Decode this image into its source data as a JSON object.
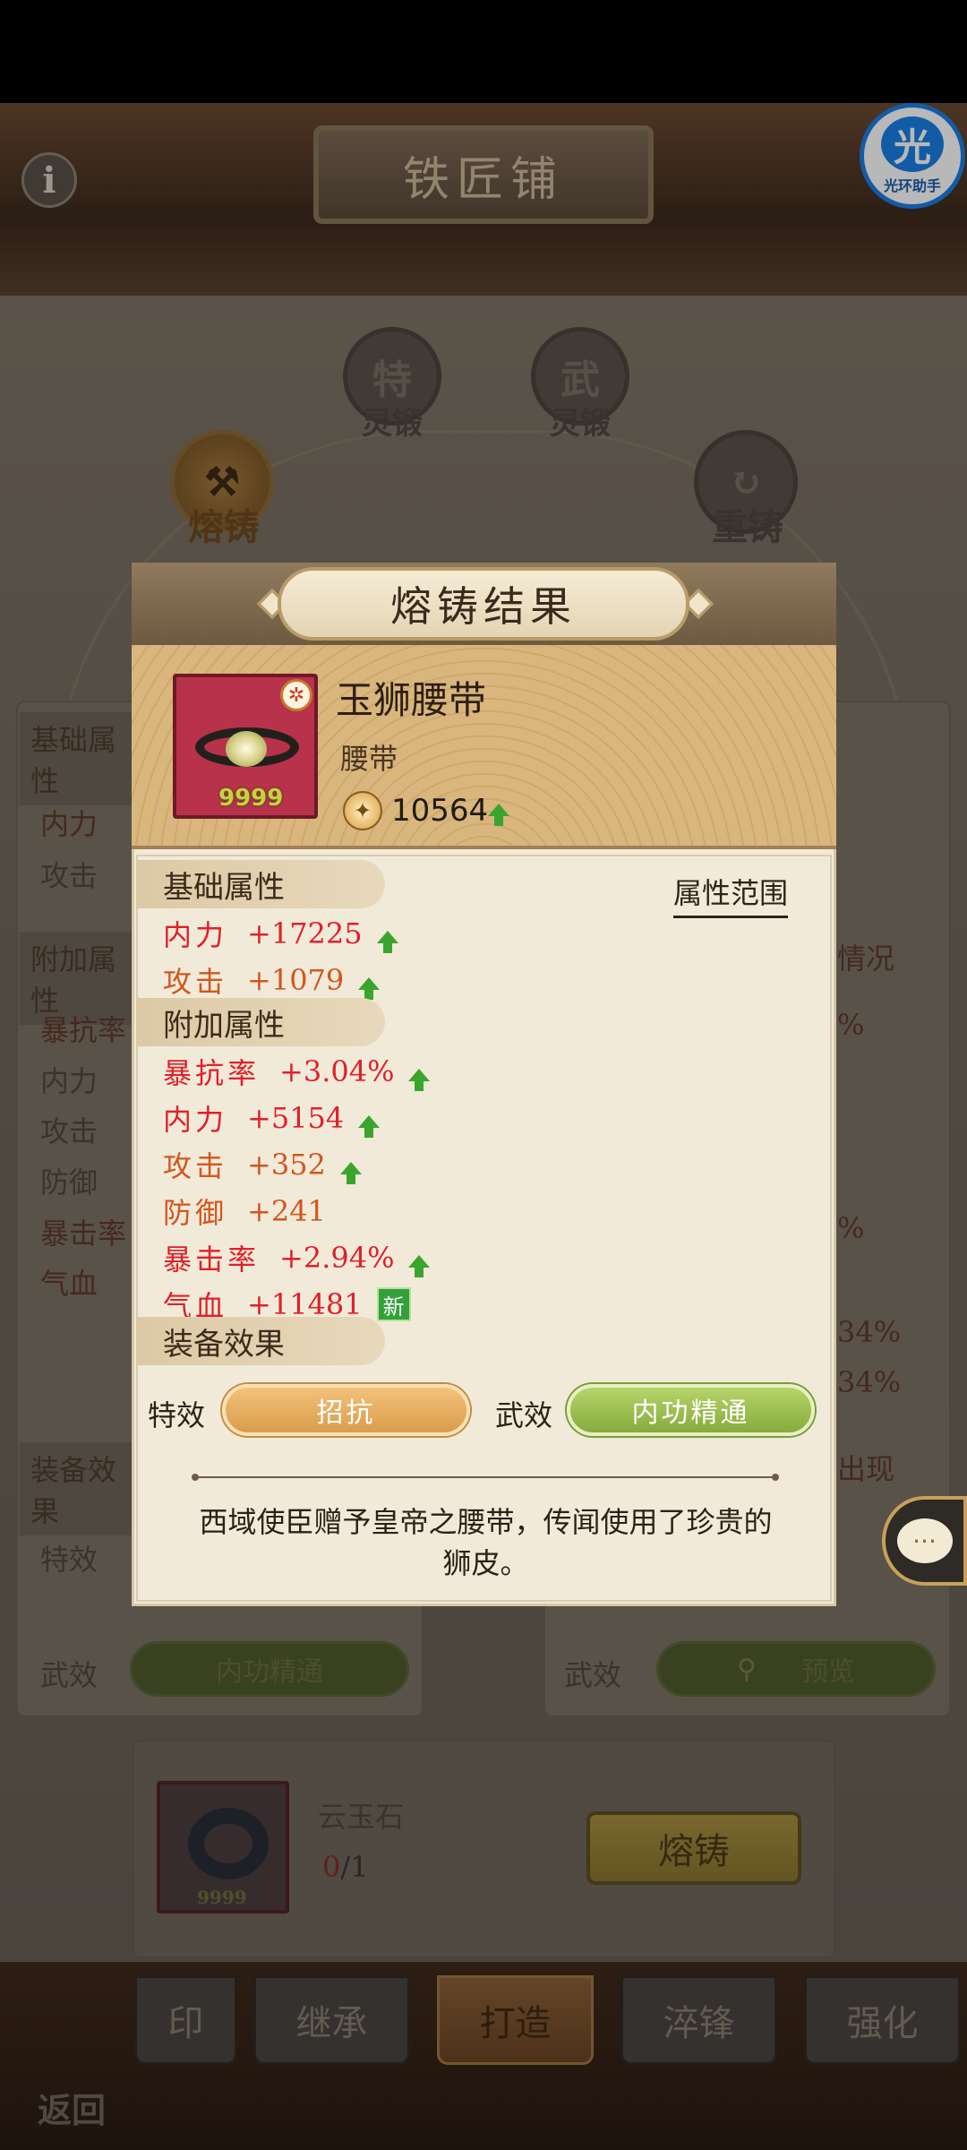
{
  "screen": {
    "title": "铁匠铺",
    "badge_label": "光环助手",
    "badge_glyph": "光"
  },
  "background": {
    "mode_buttons": [
      {
        "label": "特\n灵锻",
        "glyph": "特",
        "caption": "灵锻"
      },
      {
        "label": "武\n灵锻",
        "glyph": "武",
        "caption": "灵锻"
      },
      {
        "label": "熔铸"
      },
      {
        "label": "重铸"
      }
    ],
    "left_panel": {
      "base_title": "基础属性",
      "base_rows": [
        "内力",
        "攻击"
      ],
      "extra_title": "附加属性",
      "extra_rows": [
        "暴抗率",
        "内力",
        "攻击",
        "防御",
        "暴击率",
        "气血"
      ],
      "effect_title": "装备效果",
      "special_label": "特效",
      "martial_label": "武效",
      "martial_value": "内功精通"
    },
    "right_panel": {
      "fragments": [
        "情况",
        "%",
        "%",
        "34%",
        "34%",
        "出现"
      ],
      "martial_label": "武效",
      "preview_label": "预览"
    },
    "material": {
      "name": "云玉石",
      "have": "0",
      "need": "/1",
      "count_badge": "9999",
      "button": "熔铸"
    },
    "tabs": [
      "印",
      "继承",
      "打造",
      "淬锋",
      "强化"
    ],
    "active_tab": "打造",
    "back_label": "返回",
    "chat_glyph": "···"
  },
  "modal": {
    "title": "熔铸结果",
    "item": {
      "name": "玉狮腰带",
      "type": "腰带",
      "count": "9999",
      "badge_glyph": "✲",
      "power": "10564",
      "power_up": true
    },
    "range_link": "属性范围",
    "base_section": {
      "title": "基础属性",
      "rows": [
        {
          "name": "内力",
          "value": "+17225",
          "color": "#e0202a",
          "indicator": "up"
        },
        {
          "name": "攻击",
          "value": "+1079",
          "color": "#d2561e",
          "indicator": "up"
        }
      ]
    },
    "extra_section": {
      "title": "附加属性",
      "rows": [
        {
          "name": "暴抗率",
          "value": "+3.04%",
          "color": "#e0202a",
          "indicator": "up"
        },
        {
          "name": "内力",
          "value": "+5154",
          "color": "#e0202a",
          "indicator": "up"
        },
        {
          "name": "攻击",
          "value": "+352",
          "color": "#d2561e",
          "indicator": "up"
        },
        {
          "name": "防御",
          "value": "+241",
          "color": "#d2561e",
          "indicator": "none"
        },
        {
          "name": "暴击率",
          "value": "+2.94%",
          "color": "#e0202a",
          "indicator": "up"
        },
        {
          "name": "气血",
          "value": "+11481",
          "color": "#e0202a",
          "indicator": "new",
          "indicator_label": "新"
        }
      ]
    },
    "effect_section": {
      "title": "装备效果",
      "special_label": "特效",
      "special_value": "招抗",
      "martial_label": "武效",
      "martial_value": "内功精通"
    },
    "description": "西域使臣赠予皇帝之腰带，传闻使用了珍贵的狮皮。"
  }
}
